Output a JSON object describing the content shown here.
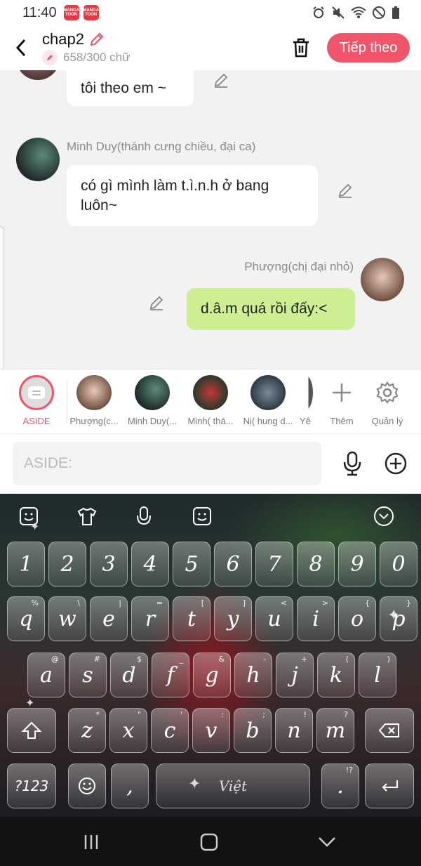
{
  "status_bar": {
    "time": "11:40",
    "app_badges": [
      "MANGA TOON",
      "MANGA TOON"
    ],
    "icons": [
      "alarm-icon",
      "mute-icon",
      "wifi-icon",
      "do-not-disturb-icon",
      "battery-icon"
    ]
  },
  "header": {
    "title": "chap2",
    "word_count": "658/300 chữ",
    "next_label": "Tiếp theo"
  },
  "messages": [
    {
      "sender": "",
      "text": "tôi theo em ~",
      "mine": false
    },
    {
      "sender": "Minh Duy(thánh cưng chiều, đại ca)",
      "text_line1": "có gì mình làm t.ì.n.h ở bang",
      "text_line2": "luôn~",
      "mine": false
    },
    {
      "sender": "Phượng(chị đại nhỏ)",
      "text": "d.â.m quá rồi đấy:<",
      "mine": true
    }
  ],
  "roles": [
    {
      "label": "ASIDE",
      "active": true
    },
    {
      "label": "Phượng(c..."
    },
    {
      "label": "Minh Duy(..."
    },
    {
      "label": "Minh( thá..."
    },
    {
      "label": "Nị( hung d..."
    },
    {
      "label": "Yê"
    }
  ],
  "role_actions": {
    "add_label": "Thêm",
    "manage_label": "Quản lý"
  },
  "input": {
    "placeholder": "ASIDE:"
  },
  "keyboard": {
    "number_row": [
      {
        "k": "1"
      },
      {
        "k": "2"
      },
      {
        "k": "3"
      },
      {
        "k": "4"
      },
      {
        "k": "5"
      },
      {
        "k": "6"
      },
      {
        "k": "7"
      },
      {
        "k": "8"
      },
      {
        "k": "9"
      },
      {
        "k": "0"
      }
    ],
    "row1": [
      {
        "k": "q",
        "h": "%"
      },
      {
        "k": "w",
        "h": "\\"
      },
      {
        "k": "e",
        "h": "|"
      },
      {
        "k": "r",
        "h": "="
      },
      {
        "k": "t",
        "h": "["
      },
      {
        "k": "y",
        "h": "]"
      },
      {
        "k": "u",
        "h": "<"
      },
      {
        "k": "i",
        "h": ">"
      },
      {
        "k": "o",
        "h": "{"
      },
      {
        "k": "p",
        "h": "}"
      }
    ],
    "row2": [
      {
        "k": "a",
        "h": "@"
      },
      {
        "k": "s",
        "h": "#"
      },
      {
        "k": "d",
        "h": "$"
      },
      {
        "k": "f",
        "h": "_"
      },
      {
        "k": "g",
        "h": "&"
      },
      {
        "k": "h",
        "h": "-"
      },
      {
        "k": "j",
        "h": "+"
      },
      {
        "k": "k",
        "h": "("
      },
      {
        "k": "l",
        "h": ")"
      }
    ],
    "row3": [
      {
        "k": "z",
        "h": "*"
      },
      {
        "k": "x",
        "h": "\""
      },
      {
        "k": "c",
        "h": "'"
      },
      {
        "k": "v",
        "h": ":"
      },
      {
        "k": "b",
        "h": ";"
      },
      {
        "k": "n",
        "h": "!"
      },
      {
        "k": "m",
        "h": "?"
      }
    ],
    "symbols_label": "?123",
    "comma": ",",
    "space_label": "Việt",
    "period": ".",
    "period_hint": "!?"
  },
  "colors": {
    "accent": "#f0546b",
    "mine_bubble": "#cdee93"
  }
}
